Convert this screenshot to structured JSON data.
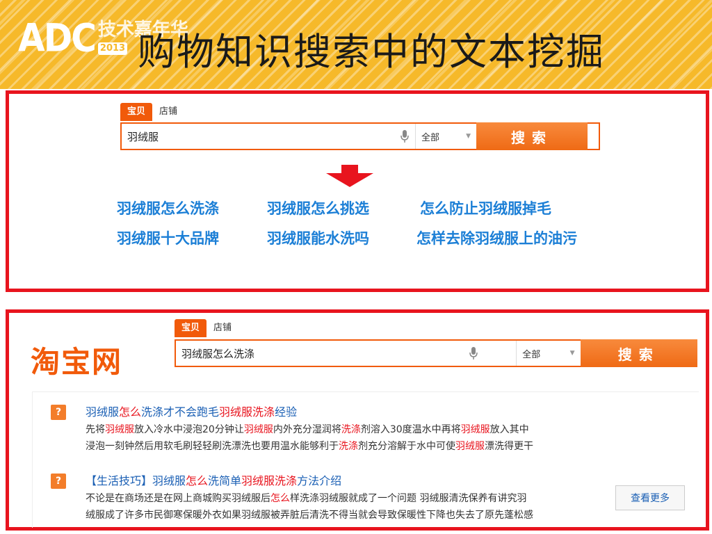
{
  "header": {
    "logo_text": "ADC",
    "logo_cn": "技术嘉年华",
    "logo_year": "2013",
    "title": "购物知识搜索中的文本挖掘"
  },
  "search1": {
    "tab_active": "宝贝",
    "tab_other": "店铺",
    "query": "羽绒服",
    "scope": "全部",
    "button": "搜索"
  },
  "suggestions": {
    "row1": [
      "羽绒服怎么洗涤",
      "羽绒服怎么挑选",
      "怎么防止羽绒服掉毛"
    ],
    "row2": [
      "羽绒服十大品牌",
      "羽绒服能水洗吗",
      "怎样去除羽绒服上的油污"
    ]
  },
  "search2": {
    "logo": "淘宝网",
    "tab_active": "宝贝",
    "tab_other": "店铺",
    "query": "羽绒服怎么洗涤",
    "scope": "全部",
    "button": "搜索"
  },
  "results": [
    {
      "icon": "?",
      "title_parts": [
        "羽绒服",
        "怎么",
        "洗涤才不会跑毛",
        "羽绒服洗涤",
        "经验"
      ],
      "line1_parts": [
        "先将",
        "羽绒服",
        "放入冷水中浸泡20分钟让",
        "羽绒服",
        "内外充分湿润将",
        "洗涤",
        "剂溶入30度温水中再将",
        "羽绒服",
        "放入其中"
      ],
      "line2_parts": [
        "浸泡一刻钟然后用软毛刷轻轻刷洗漂洗也要用温水能够利于",
        "洗涤",
        "剂充分溶解于水中可使",
        "羽绒服",
        "漂洗得更干"
      ]
    },
    {
      "icon": "?",
      "title_parts": [
        "【生活技巧】羽绒服",
        "怎么",
        "洗简单",
        "羽绒服洗涤",
        "方法介绍"
      ],
      "line1_parts": [
        "不论是在商场还是在网上商城购买羽绒服后",
        "怎么",
        "样洗涤羽绒服就成了一个问题 羽绒服清洗保养有讲究羽"
      ],
      "line2_parts": [
        "绒服成了许多市民御寒保暖外衣如果羽绒服被弄脏后清洗不得当就会导致保暖性下降也失去了原先蓬松感"
      ]
    }
  ],
  "more_button": "查看更多",
  "colors": {
    "accent": "#f15a0a",
    "frame": "#e8141e",
    "link": "#1c7fd6",
    "highlight": "#e8141e"
  }
}
